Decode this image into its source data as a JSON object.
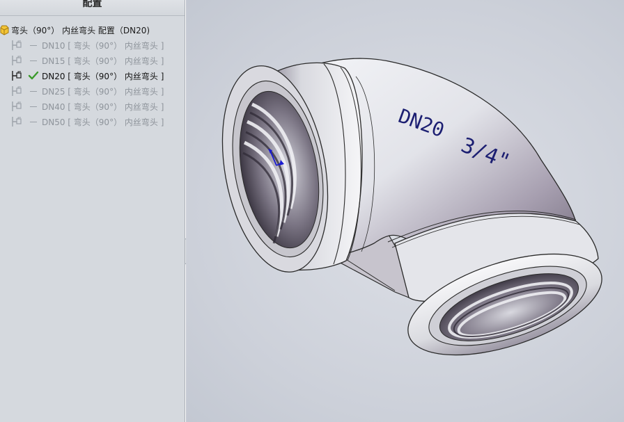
{
  "panel": {
    "title": "配置",
    "root_label": "弯头（90°） 内丝弯头 配置（DN20)",
    "configs": [
      {
        "label": "DN10 [ 弯头（90°） 内丝弯头 ]",
        "active": false
      },
      {
        "label": "DN15 [ 弯头（90°） 内丝弯头 ]",
        "active": false
      },
      {
        "label": "DN20 [ 弯头（90°） 内丝弯头 ]",
        "active": true
      },
      {
        "label": "DN25 [ 弯头（90°） 内丝弯头 ]",
        "active": false
      },
      {
        "label": "DN40 [ 弯头（90°） 内丝弯头 ]",
        "active": false
      },
      {
        "label": "DN50 [ 弯头（90°） 内丝弯头 ]",
        "active": false
      }
    ]
  },
  "model": {
    "size_text": "DN20",
    "thread_text": "3/4\"",
    "text_color": "#1c1f72",
    "axis_color": "#1a1ad0"
  },
  "colors": {
    "active_check": "#3a9a2a",
    "panel_bg": "#d5d9de",
    "viewport_bg": "#ccd0d9"
  }
}
